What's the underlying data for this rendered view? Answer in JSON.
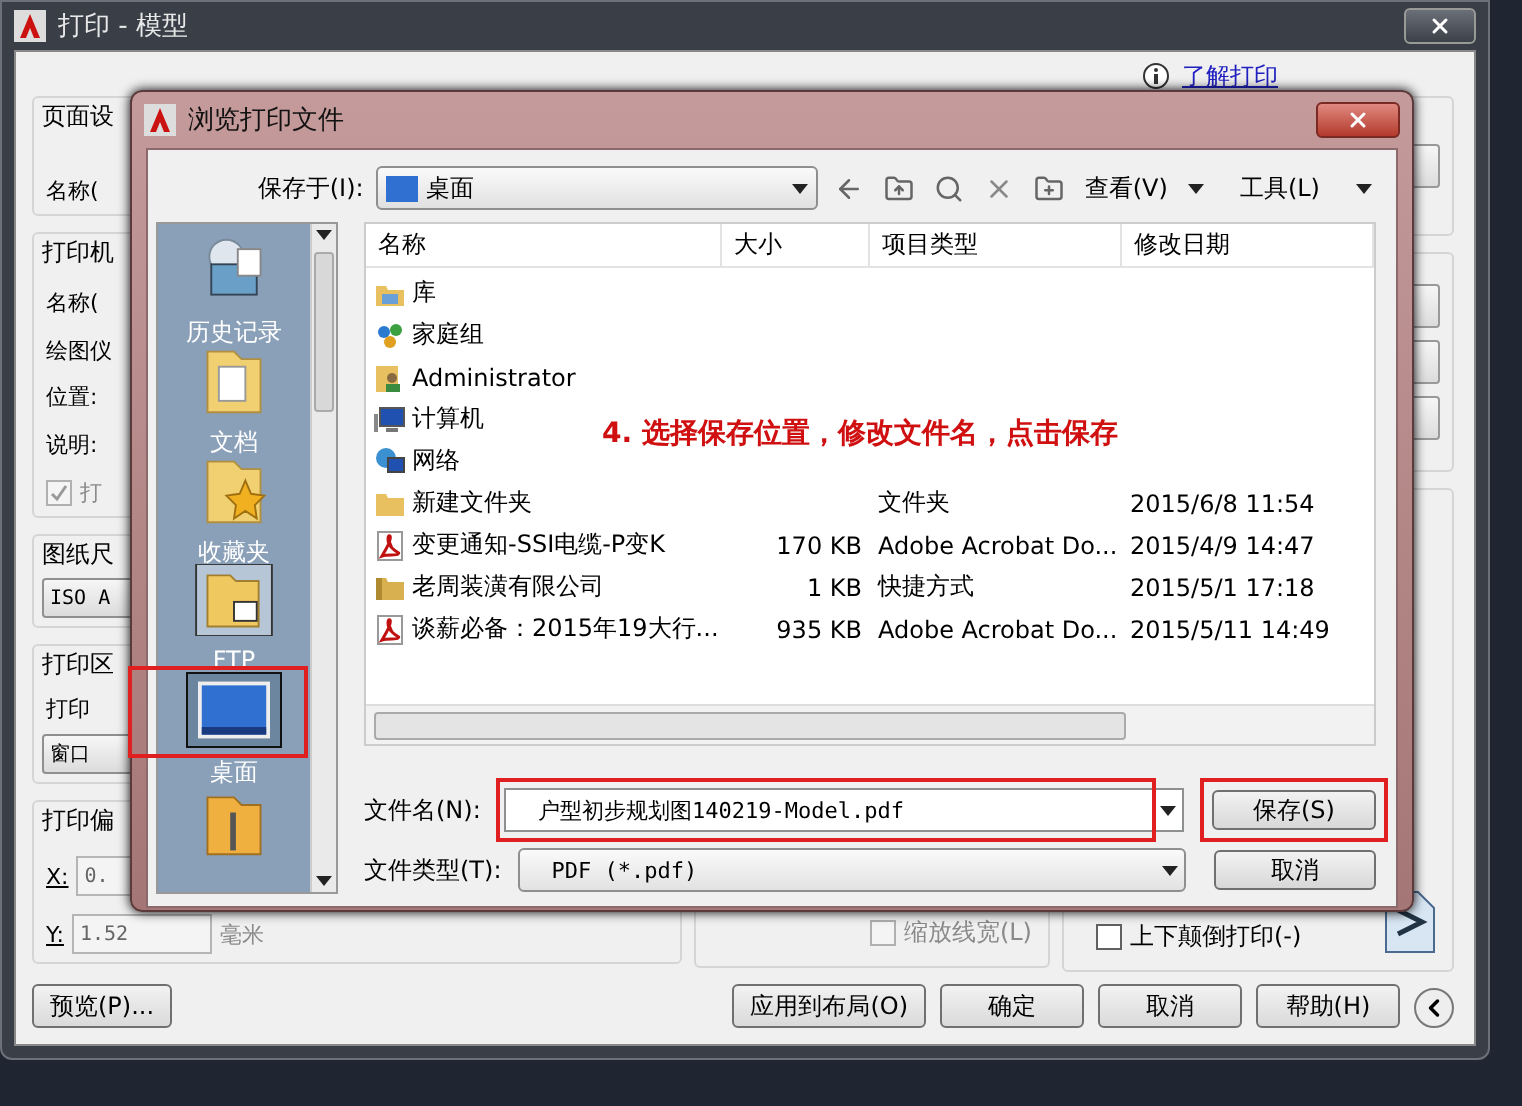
{
  "back_window": {
    "title": "打印 - 模型",
    "help_link": "了解打印",
    "groups": [
      {
        "title": "页面设",
        "items": [
          {
            "kind": "label",
            "text": "名称("
          }
        ]
      },
      {
        "title": "打印机",
        "items": [
          {
            "kind": "label",
            "text": "名称("
          },
          {
            "kind": "label",
            "text": "绘图仪"
          },
          {
            "kind": "label",
            "text": "位置:"
          },
          {
            "kind": "label",
            "text": "说明:"
          },
          {
            "kind": "checkbox",
            "text": "打",
            "checked": true,
            "disabled": true
          }
        ]
      },
      {
        "title": "图纸尺",
        "items": [
          {
            "kind": "select",
            "text": "ISO A"
          }
        ]
      },
      {
        "title": "打印区",
        "items": [
          {
            "kind": "label",
            "text": "打印"
          },
          {
            "kind": "select",
            "text": "窗口"
          }
        ]
      },
      {
        "title": "打印偏",
        "items": [
          {
            "kind": "field",
            "text": "X:",
            "value": "0."
          },
          {
            "kind": "field",
            "text": "Y:",
            "value": "1.52",
            "unit": "毫米"
          }
        ]
      }
    ],
    "scale_lineweights": {
      "label": "缩放线宽(L)",
      "checked": false,
      "disabled": true
    },
    "upside_down": {
      "label": "上下颠倒打印(-)",
      "checked": false,
      "disabled": false
    },
    "buttons": [
      {
        "label": "预览(P)..."
      },
      {
        "label": "应用到布局(O)"
      },
      {
        "label": "确定"
      },
      {
        "label": "取消"
      },
      {
        "label": "帮助(H)"
      }
    ]
  },
  "dialog": {
    "title": "浏览打印文件",
    "save_in_label": "保存于(I):",
    "save_in_value": "桌面",
    "view_menu": "查看(V)",
    "tools_menu": "工具(L)",
    "places": [
      {
        "label": "历史记录",
        "kind": "history",
        "selected": false
      },
      {
        "label": "文档",
        "kind": "documents",
        "selected": false
      },
      {
        "label": "收藏夹",
        "kind": "favorites",
        "selected": false
      },
      {
        "label": "FTP",
        "kind": "ftp",
        "selected": false
      },
      {
        "label": "桌面",
        "kind": "desktop",
        "selected": true,
        "highlighted": true
      },
      {
        "kind": "buzzsaw",
        "selected": false
      }
    ],
    "columns": [
      "名称",
      "大小",
      "项目类型",
      "修改日期"
    ],
    "rows": [
      {
        "kind": "library",
        "name": "库"
      },
      {
        "kind": "homegroup",
        "name": "家庭组"
      },
      {
        "kind": "user",
        "name": "Administrator"
      },
      {
        "kind": "computer",
        "name": "计算机"
      },
      {
        "kind": "network",
        "name": "网络"
      },
      {
        "kind": "folder",
        "name": "新建文件夹",
        "type": "文件夹",
        "date": "2015/6/8 11:54"
      },
      {
        "kind": "pdf",
        "name": "变更通知-SSI电缆-P变K",
        "size": "170 KB",
        "type": "Adobe Acrobat Do...",
        "date": "2015/4/9 14:47"
      },
      {
        "kind": "shortcut",
        "name": "老周装潢有限公司",
        "size": "1 KB",
        "type": "快捷方式",
        "date": "2015/5/1 17:18"
      },
      {
        "kind": "pdf",
        "name": "谈薪必备：2015年19大行...",
        "size": "935 KB",
        "type": "Adobe Acrobat Do...",
        "date": "2015/5/11 14:49"
      }
    ],
    "filename_label": "文件名(N):",
    "filename_value": "户型初步规划图140219-Model.pdf",
    "filename_highlighted": true,
    "filetype_label": "文件类型(T):",
    "filetype_value": "PDF (*.pdf)",
    "save_button": {
      "label": "保存(S)",
      "highlighted": true
    },
    "cancel_button": {
      "label": "取消"
    }
  },
  "annotation": {
    "text": "4. 选择保存位置，修改文件名，点击保存"
  }
}
